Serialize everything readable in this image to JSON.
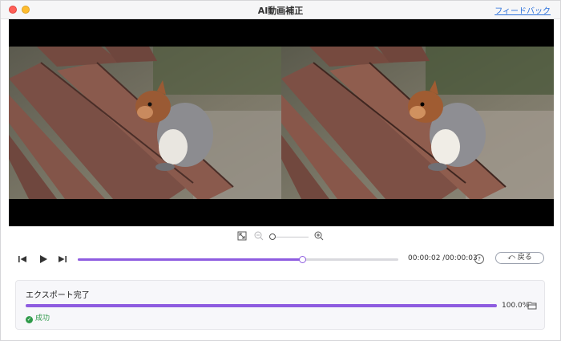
{
  "window": {
    "title": "AI動画補正",
    "feedback_link": "フィードバック"
  },
  "video": {
    "left_preview": "original-squirrel-frame",
    "right_preview": "enhanced-squirrel-frame"
  },
  "zoom": {
    "level": 0.05
  },
  "playback": {
    "progress": 0.7,
    "time_current": "00:00:02",
    "time_total": "00:00:03",
    "time_display": "00:00:02 /00:00:03",
    "help_glyph": "?",
    "back_label": "戻る"
  },
  "export": {
    "title": "エクスポート完了",
    "progress": 1.0,
    "percent_label": "100.0%",
    "status": "成功"
  },
  "colors": {
    "accent": "#8e5ce0",
    "success": "#2f9a4a",
    "link": "#2a6fdb"
  }
}
